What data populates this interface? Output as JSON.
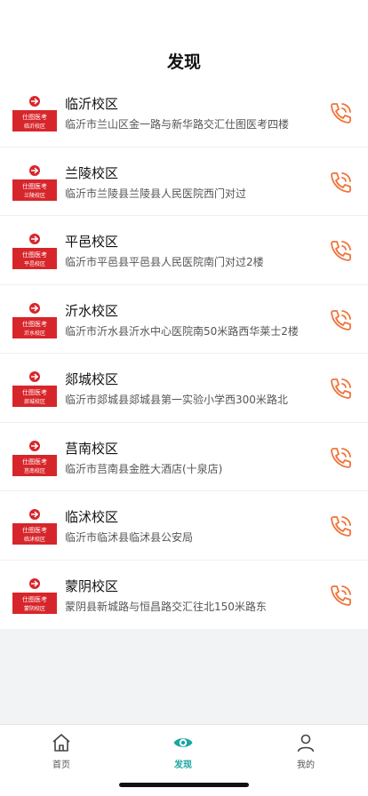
{
  "header": {
    "title": "发现"
  },
  "campuses": [
    {
      "name": "临沂校区",
      "address": "临沂市兰山区金一路与新华路交汇仕图医考四楼",
      "logo_text": "仕图医考",
      "logo_sub": "临沂校区"
    },
    {
      "name": "兰陵校区",
      "address": "临沂市兰陵县兰陵县人民医院西门对过",
      "logo_text": "仕图医考",
      "logo_sub": "兰陵校区"
    },
    {
      "name": "平邑校区",
      "address": "临沂市平邑县平邑县人民医院南门对过2楼",
      "logo_text": "仕图医考",
      "logo_sub": "平邑校区"
    },
    {
      "name": "沂水校区",
      "address": "临沂市沂水县沂水中心医院南50米路西华莱士2楼",
      "logo_text": "仕图医考",
      "logo_sub": "沂水校区"
    },
    {
      "name": "郯城校区",
      "address": "临沂市郯城县郯城县第一实验小学西300米路北",
      "logo_text": "仕图医考",
      "logo_sub": "郯城校区"
    },
    {
      "name": "莒南校区",
      "address": "临沂市莒南县金胜大酒店(十泉店)",
      "logo_text": "仕图医考",
      "logo_sub": "莒南校区"
    },
    {
      "name": "临沭校区",
      "address": "临沂市临沭县临沭县公安局",
      "logo_text": "仕图医考",
      "logo_sub": "临沭校区"
    },
    {
      "name": "蒙阴校区",
      "address": "蒙阴县新城路与恒昌路交汇往北150米路东",
      "logo_text": "仕图医考",
      "logo_sub": "蒙阴校区"
    }
  ],
  "tabbar": {
    "items": [
      {
        "label": "首页",
        "icon": "home-icon",
        "active": false
      },
      {
        "label": "发现",
        "icon": "eye-icon",
        "active": true
      },
      {
        "label": "我的",
        "icon": "user-icon",
        "active": false
      }
    ]
  },
  "colors": {
    "accent": "#1aa6a0",
    "phone": "#f0733a",
    "logo_red": "#d7262b",
    "background": "#f2f3f5"
  }
}
